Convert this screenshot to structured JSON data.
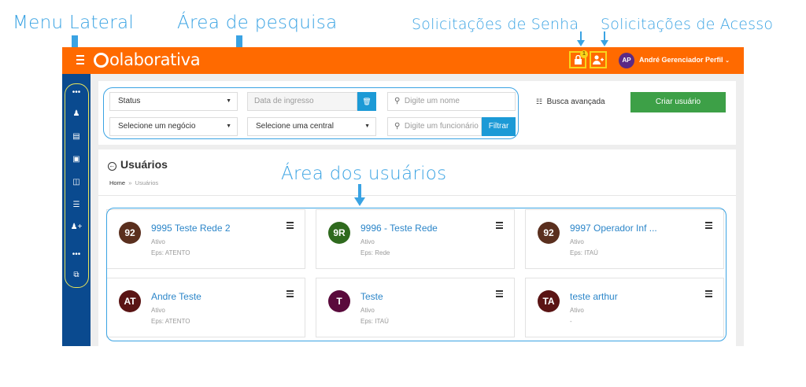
{
  "annotations": {
    "menu_lateral": "Menu Lateral",
    "area_pesquisa": "Área de pesquisa",
    "solicitacoes_senha": "Solicitações de Senha",
    "solicitacoes_acesso": "Solicitações de Acesso",
    "area_usuarios": "Área dos usuários"
  },
  "topbar": {
    "logo": "olaborativa",
    "password_badge": "1",
    "user_initials": "AP",
    "user_name": "André Gerenciador Perfil"
  },
  "search": {
    "status_label": "Status",
    "date_placeholder": "Data de ingresso",
    "name_placeholder": "Digite um nome",
    "business_label": "Selecione um negócio",
    "central_label": "Selecione uma central",
    "employee_placeholder": "Digite um funcionário",
    "filter_label": "Filtrar",
    "advanced_label": "Busca avançada",
    "create_label": "Criar usuário"
  },
  "users": {
    "title": "Usuários",
    "breadcrumb_home": "Home",
    "breadcrumb_sep": "»",
    "breadcrumb_current": "Usuários",
    "cards": [
      {
        "initials": "92",
        "name": "9995 Teste Rede 2",
        "status": "Ativo",
        "eps": "Eps: ATENTO",
        "color": "#5a2f1e"
      },
      {
        "initials": "9R",
        "name": "9996 - Teste Rede",
        "status": "Ativo",
        "eps": "Eps: Rede",
        "color": "#2f6a1e"
      },
      {
        "initials": "92",
        "name": "9997 Operador Inf ...",
        "status": "Ativo",
        "eps": "Eps: ITAÚ",
        "color": "#5a2f1e"
      },
      {
        "initials": "AT",
        "name": "Andre Teste",
        "status": "Ativo",
        "eps": "Eps: ATENTO",
        "color": "#5a1414"
      },
      {
        "initials": "T",
        "name": "Teste",
        "status": "Ativo",
        "eps": "Eps: ITAÚ",
        "color": "#5a0a3c"
      },
      {
        "initials": "TA",
        "name": "teste arthur",
        "status": "Ativo",
        "eps": "-",
        "color": "#5a1414"
      }
    ]
  },
  "colors": {
    "topbar": "#ff6a00",
    "sidebar": "#0a4a8f",
    "annotation": "#3aa3e3",
    "filter_button": "#1c9ad6",
    "create_button": "#3da047"
  }
}
